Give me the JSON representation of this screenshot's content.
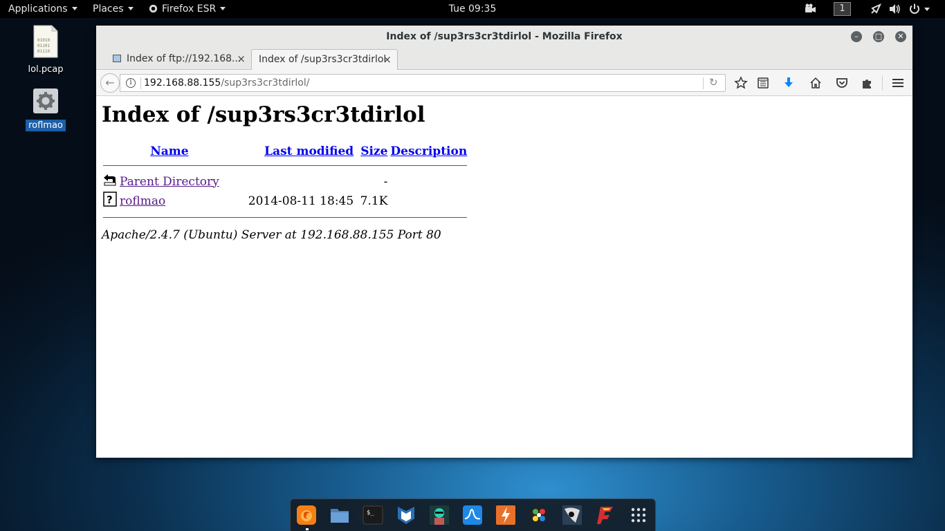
{
  "top_panel": {
    "applications": "Applications",
    "places": "Places",
    "firefox": "Firefox ESR",
    "clock": "Tue 09:35",
    "workspace": "1"
  },
  "desktop": {
    "icons": [
      {
        "label": "lol.pcap",
        "icon": "binary-file-icon"
      },
      {
        "label": "roflmao",
        "icon": "executable-gear-icon",
        "selected": true
      }
    ]
  },
  "window": {
    "title": "Index of /sup3rs3cr3tdirlol - Mozilla Firefox",
    "tabs": [
      {
        "label": "Index of ftp://192.168...",
        "active": false
      },
      {
        "label": "Index of /sup3rs3cr3tdirlol",
        "active": true
      }
    ],
    "url": {
      "host": "192.168.88.155",
      "path": "/sup3rs3cr3tdirlol/"
    }
  },
  "page": {
    "heading": "Index of /sup3rs3cr3tdirlol",
    "columns": {
      "name": "Name",
      "modified": "Last modified",
      "size": "Size",
      "description": "Description"
    },
    "rows": [
      {
        "name": "Parent Directory",
        "modified": "",
        "size": "-",
        "description": "",
        "icon": "back-arrow-icon"
      },
      {
        "name": "roflmao",
        "modified": "2014-08-11 18:45",
        "size": "7.1K",
        "description": "",
        "icon": "unknown-file-icon"
      }
    ],
    "address": "Apache/2.4.7 (Ubuntu) Server at 192.168.88.155 Port 80"
  },
  "dock": {
    "items": [
      "firefox-icon",
      "files-icon",
      "terminal-icon",
      "metasploit-icon",
      "armitage-icon",
      "burpsuite-icon",
      "wireshark-icon",
      "maltego-icon",
      "faraday-icon",
      "leafpad-icon",
      "show-apps-icon"
    ]
  },
  "colors": {
    "link": "#0000ee",
    "visited_link": "#551a8b",
    "selected_label": "#1d5fa7",
    "titlebar": "#e8e8e7",
    "download_arrow": "#0a84ff"
  }
}
